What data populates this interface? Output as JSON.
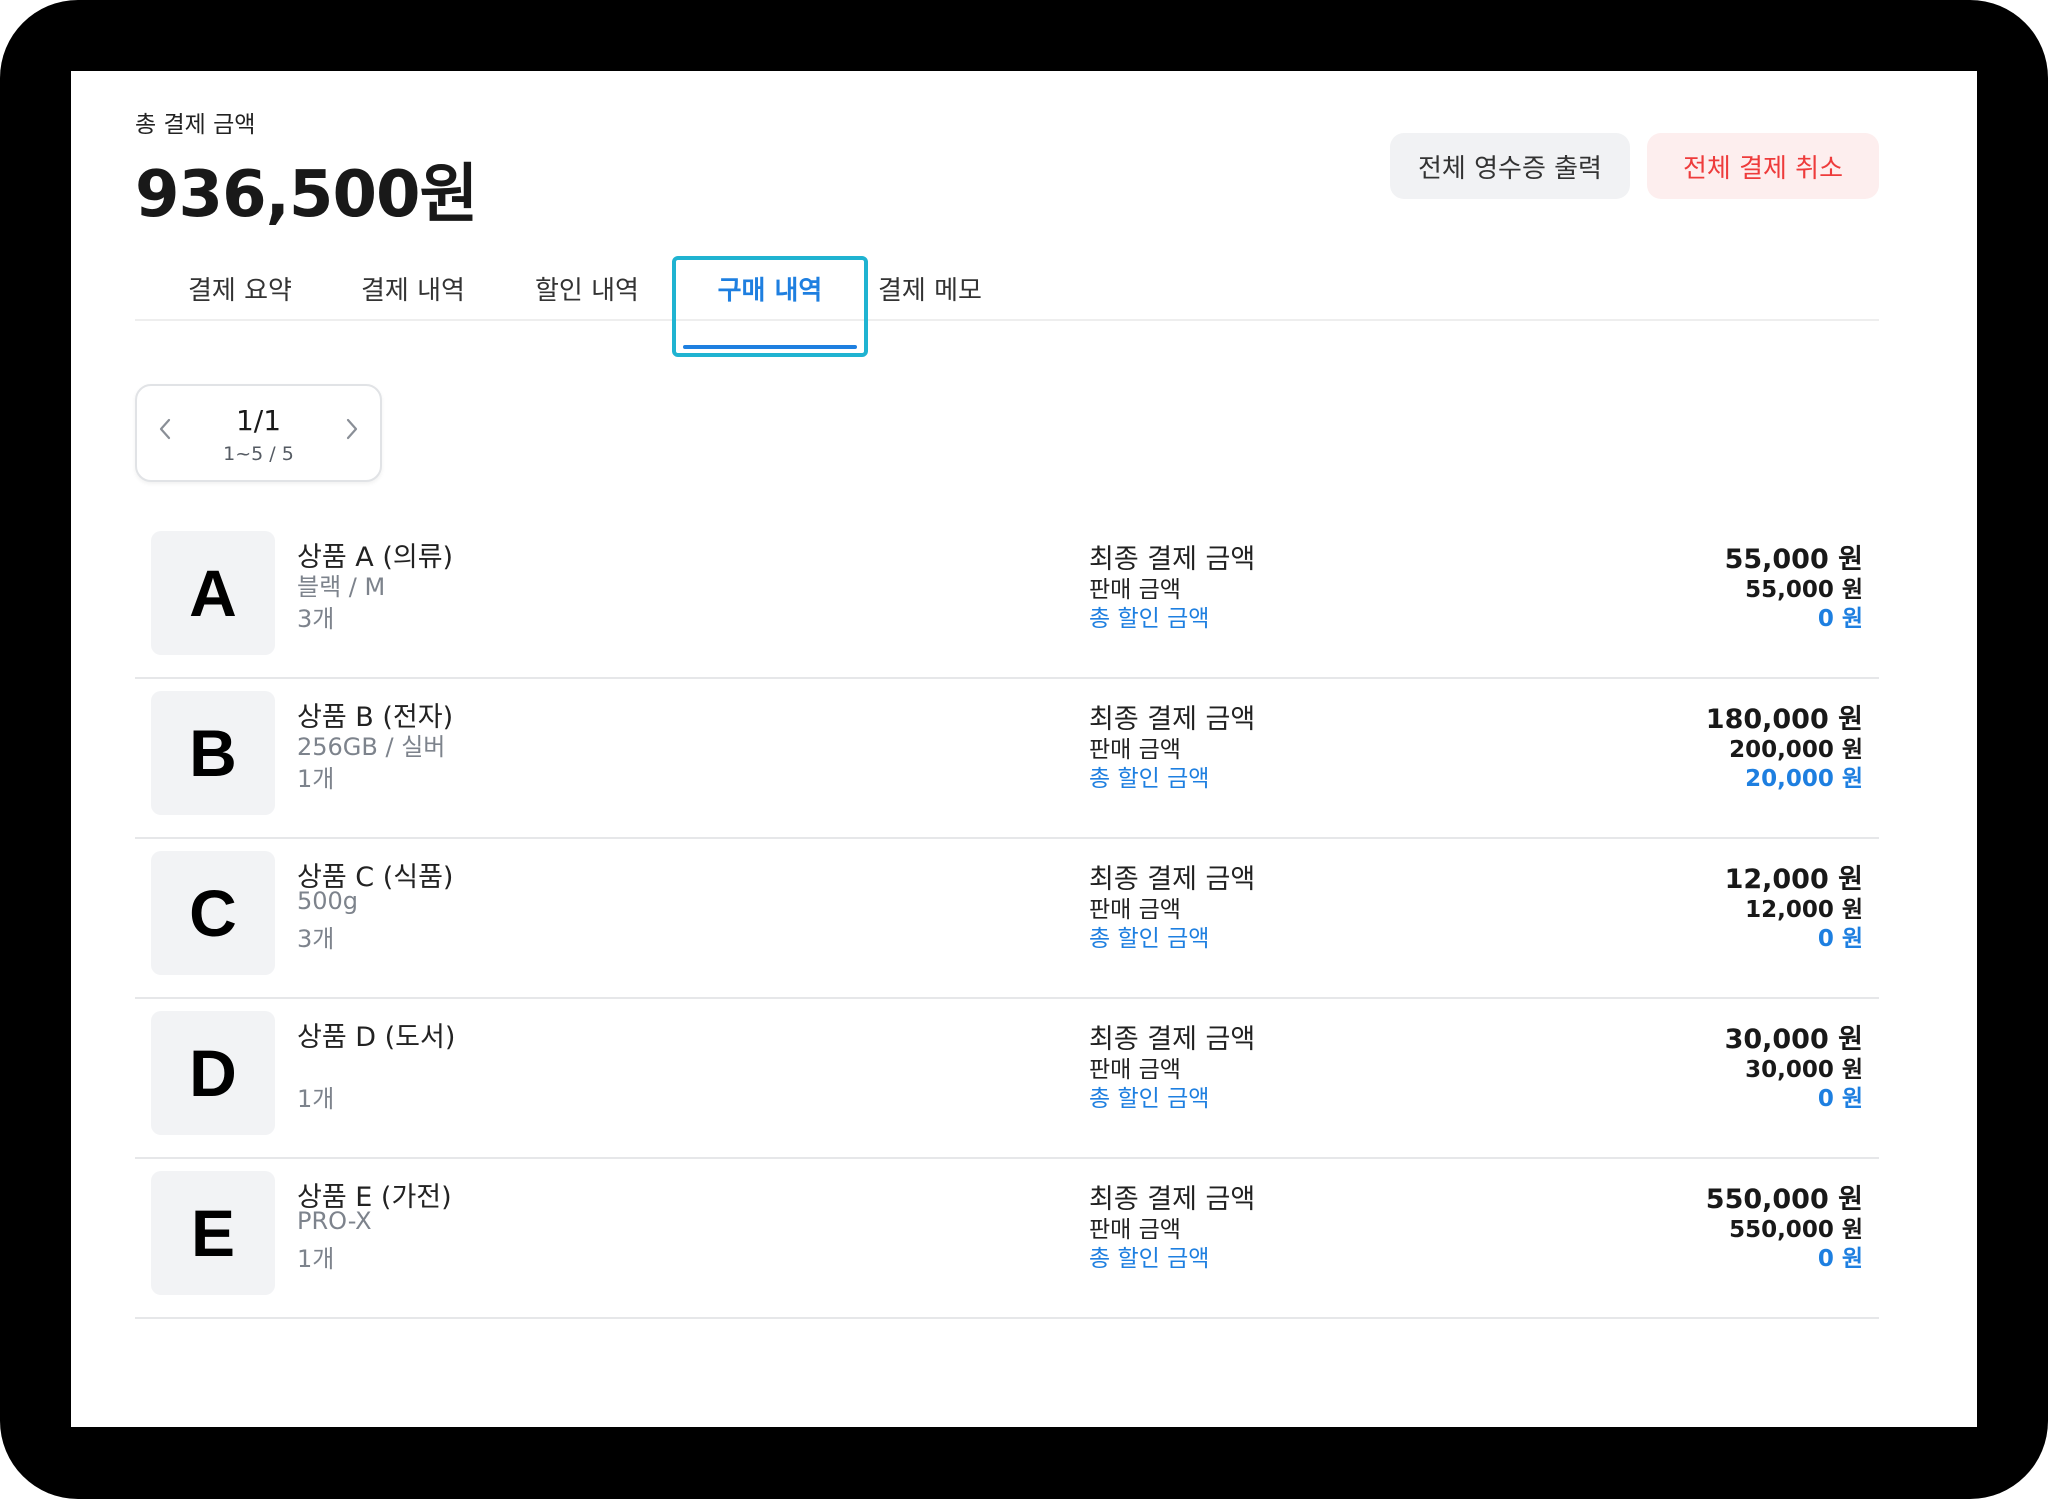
{
  "summary": {
    "total_label": "총 결제 금액",
    "total_amount": "936,500원"
  },
  "actions": {
    "receipt_label": "전체 영수증 출력",
    "cancel_label": "전체 결제 취소"
  },
  "tabs": [
    {
      "label": "결제 요약",
      "active": false
    },
    {
      "label": "결제 내역",
      "active": false
    },
    {
      "label": "할인 내역",
      "active": false
    },
    {
      "label": "구매 내역",
      "active": true
    },
    {
      "label": "결제 메모",
      "active": false
    }
  ],
  "pager": {
    "page": "1/1",
    "range": "1~5 / 5",
    "prev_icon": "chevron-left-icon",
    "next_icon": "chevron-right-icon"
  },
  "labels": {
    "final": "최종 결제 금액",
    "sale": "판매 금액",
    "discount": "총 할인 금액"
  },
  "items": [
    {
      "thumb": "A",
      "name": "상품 A (의류)",
      "option": "블랙 / M",
      "qty": "3개",
      "final": "55,000 원",
      "sale": "55,000 원",
      "discount": "0 원"
    },
    {
      "thumb": "B",
      "name": "상품 B (전자)",
      "option": "256GB / 실버",
      "qty": "1개",
      "final": "180,000 원",
      "sale": "200,000 원",
      "discount": "20,000 원"
    },
    {
      "thumb": "C",
      "name": "상품 C (식품)",
      "option": "500g",
      "qty": "3개",
      "final": "12,000 원",
      "sale": "12,000 원",
      "discount": "0 원"
    },
    {
      "thumb": "D",
      "name": "상품 D (도서)",
      "option": "",
      "qty": "1개",
      "final": "30,000 원",
      "sale": "30,000 원",
      "discount": "0 원"
    },
    {
      "thumb": "E",
      "name": "상품 E (가전)",
      "option": "PRO-X",
      "qty": "1개",
      "final": "550,000 원",
      "sale": "550,000 원",
      "discount": "0 원"
    }
  ],
  "colors": {
    "accent": "#1e7fe0",
    "danger": "#ee3b3b",
    "focus_ring": "#1fb3d1"
  }
}
